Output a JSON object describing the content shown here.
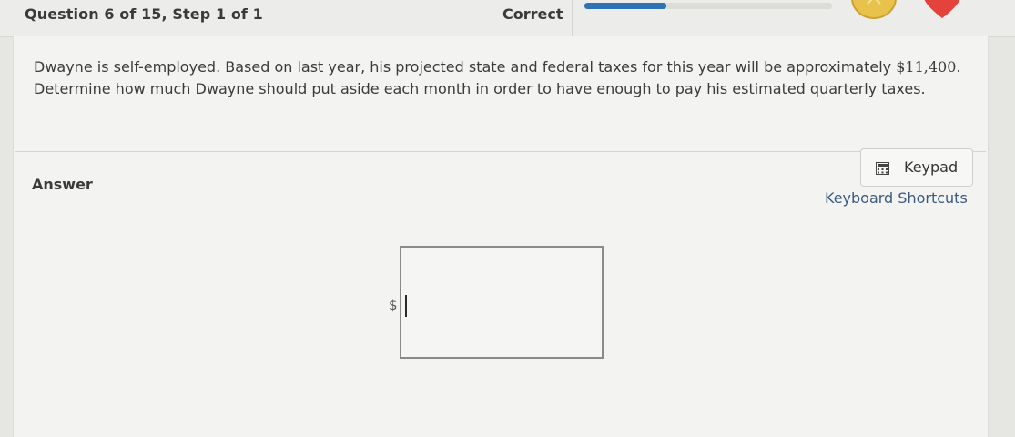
{
  "header": {
    "question_label": "Question 6 of 15, Step 1 of 1",
    "status": "Correct",
    "progress_fraction": 0.33,
    "colors": {
      "progress": "#2e73b7",
      "medal": "#e8c24a",
      "heart": "#e3433b"
    }
  },
  "question": {
    "text_before_amount": "Dwayne is self-employed. Based on last year, his projected state and federal taxes for this year will be approximately ",
    "amount": "$11,400.",
    "text_second_line": "Determine how much Dwayne should put aside each month in order to have enough to pay his estimated quarterly taxes."
  },
  "answer": {
    "label": "Answer",
    "currency_prefix": "$",
    "input_value": ""
  },
  "tools": {
    "keypad_label": "Keypad",
    "keypad_icon": "calculator-icon",
    "shortcuts_label": "Keyboard Shortcuts"
  }
}
